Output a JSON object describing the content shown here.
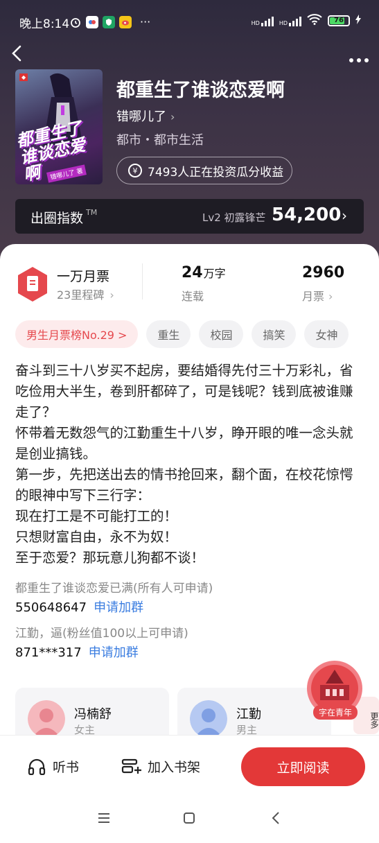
{
  "status": {
    "time": "晚上8:14",
    "dots": "···",
    "hd1": "HD",
    "hd2": "HD",
    "battery": "76"
  },
  "nav": {
    "back": "<",
    "more": "•••"
  },
  "book": {
    "cover_title": "都重生了谁谈恋爱啊",
    "cover_author": "错哪儿了 著",
    "title": "都重生了谁谈恋爱啊",
    "author": "错哪儿了",
    "genre": "都市・都市生活",
    "invest_text": "7493人正在投资瓜分收益"
  },
  "index": {
    "label": "出圈指数",
    "tm": "TM",
    "level": "Lv2 初露锋芒",
    "value": "54,200"
  },
  "stats": {
    "ticket_title": "一万月票",
    "ticket_sub": "23里程碑",
    "words_value": "24",
    "words_unit": "万字",
    "words_sub": "连载",
    "monthly_value": "2960",
    "monthly_sub": "月票"
  },
  "tags": [
    "男生月票榜No.29 >",
    "重生",
    "校园",
    "搞笑",
    "女神"
  ],
  "description": [
    "奋斗到三十八岁买不起房，要结婚得先付三十万彩礼，省吃俭用大半生，卷到肝都碎了，可是钱呢？钱到底被谁赚走了？",
    "怀带着无数怨气的江勤重生十八岁，睁开眼的唯一念头就是创业搞钱。",
    "第一步，先把送出去的情书抢回来，翻个面，在校花惊愕的眼神中写下三行字：",
    "现在打工是不可能打工的！",
    "只想财富自由，永不为奴！",
    "至于恋爱？那玩意儿狗都不谈！"
  ],
  "groups": [
    {
      "label": "都重生了谁谈恋爱已满(所有人可申请)",
      "number": "550648647",
      "action": "申请加群"
    },
    {
      "label": "江勤，逼(粉丝值100以上可申请)",
      "number": "871***317",
      "action": "申请加群"
    }
  ],
  "characters": [
    {
      "name": "冯楠舒",
      "role": "女主"
    },
    {
      "name": "江勤",
      "role": "男主"
    }
  ],
  "more_card": "更多",
  "badge": "字在青年",
  "bottom": {
    "listen": "听书",
    "shelf": "加入书架",
    "read": "立即阅读"
  },
  "colors": {
    "accent": "#e33838",
    "link": "#3b7de0",
    "header_bg": "#3d3346"
  }
}
